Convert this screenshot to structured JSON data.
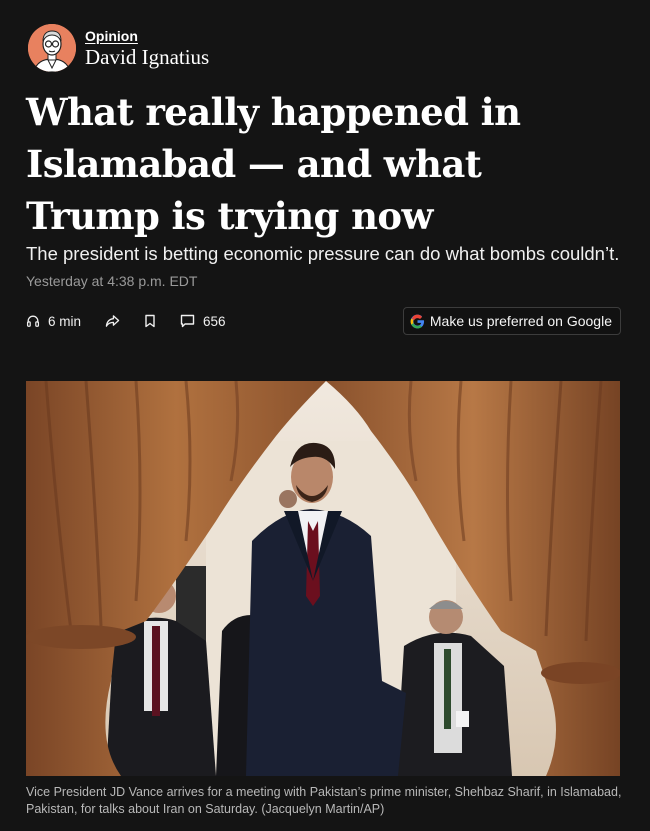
{
  "byline": {
    "section_label": "Opinion",
    "author": "David Ignatius"
  },
  "article": {
    "headline": "What really happened in Islamabad — and what Trump is trying now",
    "dek": "The president is betting economic pressure can do what bombs couldn’t.",
    "timestamp": "Yesterday at 4:38 p.m. EDT"
  },
  "toolbar": {
    "listen_label": "6 min",
    "listen_icon": "headphones-icon",
    "share_icon": "share-arrow-icon",
    "save_icon": "bookmark-icon",
    "comments_icon": "comment-icon",
    "comments_count": "656",
    "google_label": "Make us preferred on Google"
  },
  "photo": {
    "caption": "Vice President JD Vance arrives for a meeting with Pakistan’s prime minister, Shehbaz Sharif, in Islamabad, Pakistan, for talks about Iran on Saturday. (Jacquelyn Martin/AP)"
  },
  "colors": {
    "background": "#141414",
    "text": "#ffffff",
    "muted": "#9a9a9a",
    "avatar_bg": "#e8815f",
    "curtain": "#a0623a"
  }
}
